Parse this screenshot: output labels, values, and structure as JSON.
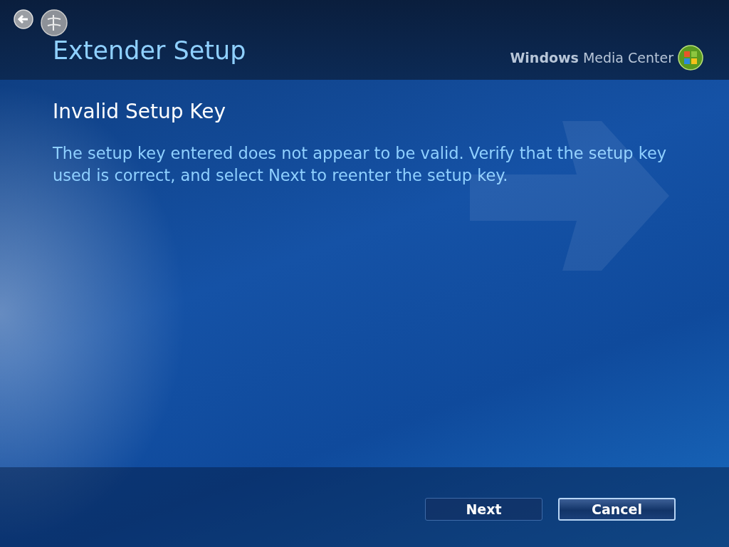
{
  "window": {
    "title": "Extender Setup",
    "brand": "**Windows** Media Center"
  },
  "page": {
    "heading": "Invalid Setup Key",
    "message": "The setup key entered does not appear to be valid. Verify that the setup key used is correct, and select Next to reenter the setup key."
  },
  "buttons": [
    {
      "label": "Next",
      "focused": false
    },
    {
      "label": "Cancel",
      "focused": true
    }
  ]
}
